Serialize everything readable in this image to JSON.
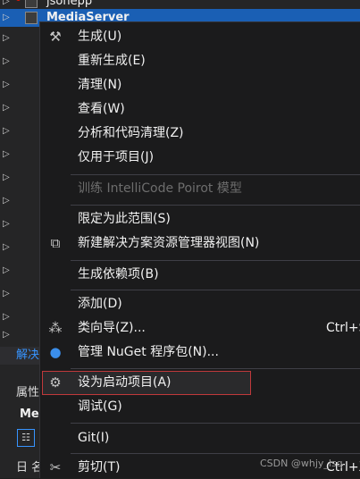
{
  "tree": {
    "top_item": "jsonepp",
    "selected_item": "MediaServer"
  },
  "solution_tab": "解决",
  "properties": {
    "title": "属性",
    "object_label": "Me",
    "expander": "日 名"
  },
  "menu": {
    "items": [
      {
        "label": "生成(U)",
        "icon": "build-icon"
      },
      {
        "label": "重新生成(E)"
      },
      {
        "label": "清理(N)"
      },
      {
        "label": "查看(W)"
      },
      {
        "label": "分析和代码清理(Z)"
      },
      {
        "label": "仅用于项目(J)"
      },
      {
        "label": "训练 IntelliCode Poirot 模型",
        "disabled": true
      },
      {
        "label": "限定为此范围(S)"
      },
      {
        "label": "新建解决方案资源管理器视图(N)",
        "icon": "new-view-icon"
      },
      {
        "label": "生成依赖项(B)"
      },
      {
        "label": "添加(D)"
      },
      {
        "label": "类向导(Z)...",
        "shortcut": "Ctrl+S",
        "icon": "class-wizard-icon"
      },
      {
        "label": "管理 NuGet 程序包(N)...",
        "icon": "nuget-icon"
      },
      {
        "label": "设为启动项目(A)",
        "icon": "gear-icon",
        "highlighted": true
      },
      {
        "label": "调试(G)"
      },
      {
        "label": "Git(I)"
      },
      {
        "label": "剪切(T)",
        "shortcut": "Ctrl+X",
        "icon": "scissors-icon"
      }
    ]
  },
  "watermark": "CSDN @whjy_lsq",
  "colors": {
    "selection": "#1a5fb4",
    "menu_bg": "#1b1b1c",
    "highlight_border": "#c0393b",
    "disabled_text": "#6d6d6d"
  }
}
